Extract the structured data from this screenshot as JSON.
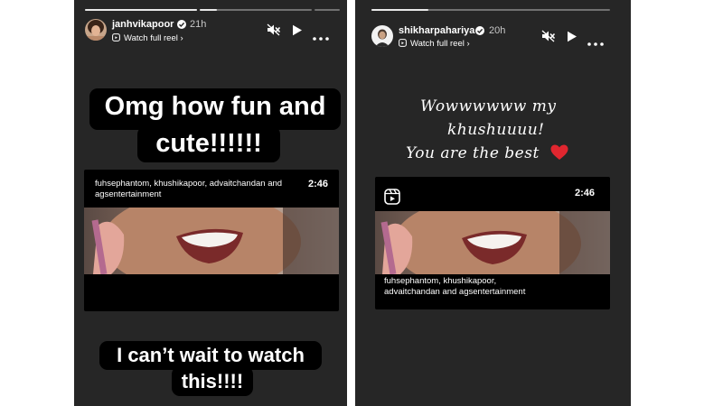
{
  "stories": [
    {
      "username": "janhvikapoor",
      "time": "21h",
      "watch_label": "Watch full reel",
      "progress": [
        1.0,
        0.15,
        0.0
      ],
      "caption_top": [
        "Omg how fun and",
        "cute!!!!!!"
      ],
      "caption_bottom": [
        "I can’t wait to watch",
        "this!!!!"
      ],
      "reel": {
        "credits": "fuhsephantom, khushikapoor, advaitchandan and agsentertainment",
        "duration": "2:46"
      }
    },
    {
      "username": "shikharpahariya",
      "time": "20h",
      "watch_label": "Watch full reel",
      "progress": [
        0.24
      ],
      "message": [
        "Wowwwwww my",
        "khushuuuu!",
        "You are the best"
      ],
      "emoji": "red-heart-icon",
      "reel": {
        "credits_lines": [
          "fuhsephantom, khushikapoor,",
          "advaitchandan and agsentertainment"
        ],
        "duration": "2:46"
      }
    }
  ],
  "colors": {
    "story_bg": "#262626",
    "heart": "#e0262f",
    "caption_bg": "#000000"
  }
}
